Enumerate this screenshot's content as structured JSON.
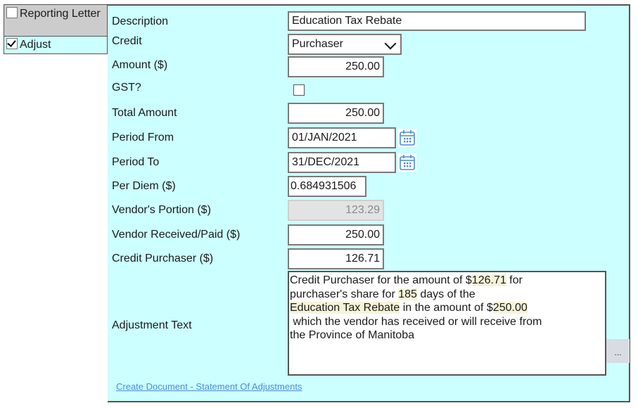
{
  "left_panel": {
    "items": [
      {
        "label": "Reporting Letter",
        "checked": false
      },
      {
        "label": "Adjust",
        "checked": true
      }
    ]
  },
  "form": {
    "description": {
      "label": "Description",
      "value": "Education Tax Rebate"
    },
    "credit": {
      "label": "Credit",
      "value": "Purchaser"
    },
    "amount": {
      "label": "Amount ($)",
      "value": "250.00"
    },
    "gst": {
      "label": "GST?",
      "checked": false
    },
    "total_amount": {
      "label": "Total Amount",
      "value": "250.00"
    },
    "period_from": {
      "label": "Period From",
      "value": "01/JAN/2021",
      "icon": "calendar-icon"
    },
    "period_to": {
      "label": "Period To",
      "value": "31/DEC/2021",
      "icon": "calendar-icon"
    },
    "per_diem": {
      "label": "Per Diem ($)",
      "value": "0.684931506"
    },
    "vendors_portion": {
      "label": "Vendor's Portion ($)",
      "value": "123.29"
    },
    "vendor_received": {
      "label": "Vendor Received/Paid ($)",
      "value": "250.00"
    },
    "credit_purchaser": {
      "label": "Credit Purchaser ($)",
      "value": "126.71"
    },
    "adjustment_text": {
      "label": "Adjustment Text",
      "parts": {
        "p1": "Credit Purchaser for the amount of $",
        "h1": "126.71",
        "p2": " for\npurchaser's share for ",
        "h2": "185",
        "p3": " days of the\n",
        "h3": "Education Tax Rebate",
        "p4": " in the amount of $",
        "h4": "250.00",
        "p5": "\n which the vendor has received or will receive from\nthe Province of Manitoba"
      }
    },
    "ellipsis_label": "...",
    "create_document_link": "Create Document - Statement Of Adjustments"
  },
  "colors": {
    "panel_bg": "#ccffff",
    "tab_inactive_bg": "#cccccc",
    "link": "#4a8cd9",
    "highlight": "#f6f4d8",
    "calendar_icon": "#4a8cd9"
  }
}
